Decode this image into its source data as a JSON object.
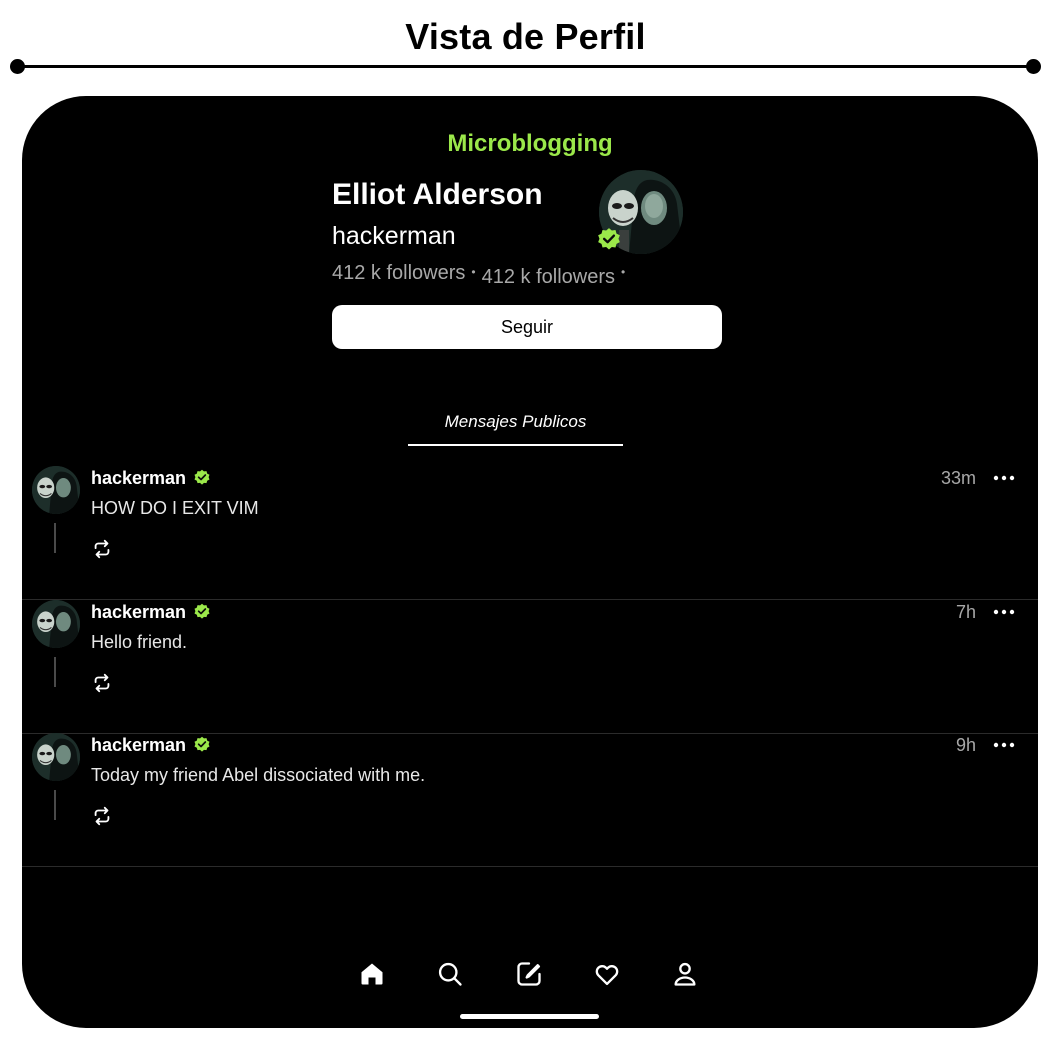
{
  "page": {
    "heading": "Vista de Perfil"
  },
  "app": {
    "brand": "Microblogging",
    "accent_color": "#9be84a"
  },
  "profile": {
    "name": "Elliot Alderson",
    "handle": "hackerman",
    "followers_1": "412 k followers",
    "followers_2": "412 k followers",
    "separator": "•",
    "avatar_icon": "profile-photo",
    "verified_icon": "verified-badge-icon",
    "follow_label": "Seguir"
  },
  "tabs": {
    "active": "Mensajes Publicos"
  },
  "posts": [
    {
      "user": "hackerman",
      "text": "HOW DO I EXIT VIM",
      "time": "33m"
    },
    {
      "user": "hackerman",
      "text": "Hello friend.",
      "time": "7h"
    },
    {
      "user": "hackerman",
      "text": "Today my friend Abel dissociated with me.",
      "time": "9h"
    }
  ],
  "nav": {
    "items": [
      "home-icon",
      "search-icon",
      "compose-icon",
      "heart-icon",
      "user-icon"
    ],
    "active": "home-icon"
  }
}
